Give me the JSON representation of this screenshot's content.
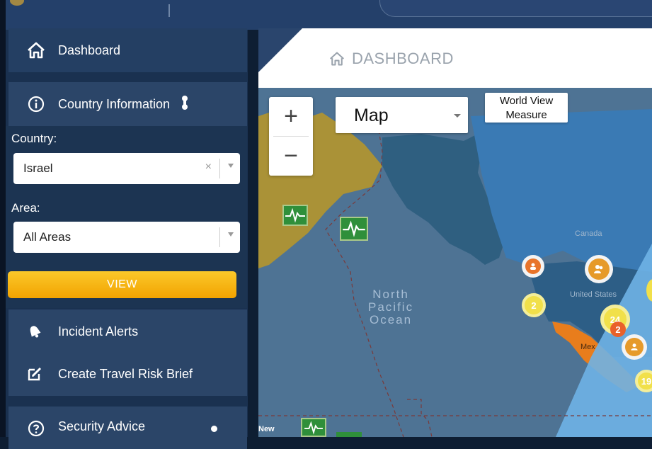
{
  "sidebar": {
    "dashboard_label": "Dashboard",
    "country_information_label": "Country Information",
    "country_label": "Country:",
    "country_value": "Israel",
    "country_clear": "×",
    "area_label": "Area:",
    "area_value": "All Areas",
    "view_button": "VIEW",
    "incident_alerts_label": "Incident Alerts",
    "create_brief_label": "Create Travel Risk Brief",
    "security_advice_label": "Security Advice"
  },
  "main": {
    "tab_title": "DASHBOARD"
  },
  "map": {
    "zoom_in": "+",
    "zoom_out": "−",
    "map_type": "Map",
    "world_view_line1": "World View",
    "world_view_line2": "Measure",
    "ocean_line1": "North",
    "ocean_line2": "Pacific",
    "ocean_line3": "Ocean",
    "label_canada": "Canada",
    "label_us": "United States",
    "label_mexico": "Mex",
    "label_new": "New",
    "cluster_2a": "2",
    "cluster_24": "24",
    "cluster_2b": "2",
    "cluster_19": "19"
  },
  "colors": {
    "accent_yellow": "#f2a300",
    "sidebar_bg": "#2b4568",
    "map_water": "#4e7394"
  }
}
